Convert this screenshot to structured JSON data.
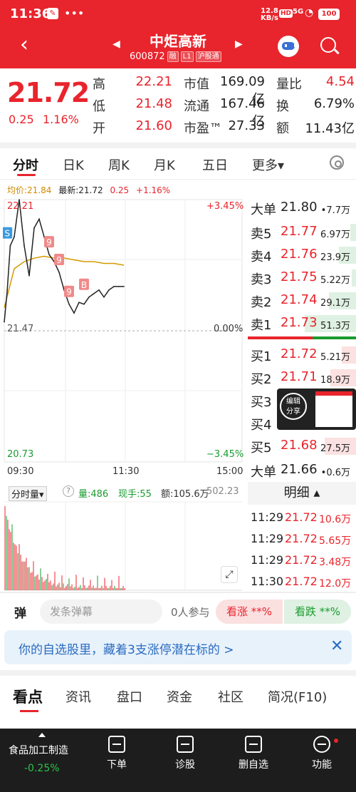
{
  "status_bar": {
    "time": "11:36",
    "net_speed": "12.8",
    "net_unit": "KB/s",
    "hd": "HD",
    "signal": "5G",
    "battery": "100"
  },
  "header": {
    "stock_name": "中炬高新",
    "stock_code": "600872",
    "tags": [
      "融",
      "L1",
      "沪股通"
    ]
  },
  "quote": {
    "price": "21.72",
    "change": "0.25",
    "change_pct": "1.16%",
    "rows": [
      {
        "l1": "高",
        "v1": "22.21",
        "l2": "市值",
        "v2": "169.09亿",
        "l3": "量比",
        "v3": "4.54"
      },
      {
        "l1": "低",
        "v1": "21.48",
        "l2": "流通",
        "v2": "167.46亿",
        "l3": "换",
        "v3": "6.79%"
      },
      {
        "l1": "开",
        "v1": "21.60",
        "l2": "市盈™",
        "v2": "27.33",
        "l3": "额",
        "v3": "11.43亿"
      }
    ]
  },
  "tabs": [
    "分时",
    "日K",
    "周K",
    "月K",
    "五日",
    "更多▾"
  ],
  "info_line": {
    "avg_label": "均价:21.84",
    "latest_label": "最新:21.72",
    "chg": "0.25",
    "chg_pct": "+1.16%"
  },
  "chart_labels": {
    "top_left": "22.21",
    "top_right": "+3.45%",
    "mid_left": "21.47",
    "mid_right": "0.00%",
    "bot_left": "20.73",
    "bot_right": "−3.45%",
    "time_start": "09:30",
    "time_mid": "11:30",
    "time_end": "15:00"
  },
  "volume_bar": {
    "label": "分时量▾",
    "vol": "量:486",
    "now": "现手:55",
    "amount": "额:105.6万",
    "max": "502.23"
  },
  "order_book": {
    "big_sell": {
      "k": "大单",
      "p": "21.80",
      "v": "•7.7万"
    },
    "asks": [
      {
        "k": "卖5",
        "p": "21.77",
        "v": "6.97万"
      },
      {
        "k": "卖4",
        "p": "21.76",
        "v": "23.9万"
      },
      {
        "k": "卖3",
        "p": "21.75",
        "v": "5.22万"
      },
      {
        "k": "卖2",
        "p": "21.74",
        "v": "29.1万"
      },
      {
        "k": "卖1",
        "p": "21.73",
        "v": "51.3万"
      }
    ],
    "bids": [
      {
        "k": "买1",
        "p": "21.72",
        "v": "5.21万"
      },
      {
        "k": "买2",
        "p": "21.71",
        "v": "18.9万"
      },
      {
        "k": "买3",
        "p": "",
        "v": ""
      },
      {
        "k": "买4",
        "p": "",
        "v": ""
      },
      {
        "k": "买5",
        "p": "21.68",
        "v": "27.5万"
      }
    ],
    "big_buy": {
      "k": "大单",
      "p": "21.66",
      "v": "•0.6万"
    }
  },
  "share_widget": {
    "l1": "编辑",
    "l2": "分享"
  },
  "detail": {
    "title": "明细 ▴",
    "rows": [
      {
        "t": "11:29",
        "p": "21.72",
        "v": "10.6万"
      },
      {
        "t": "11:29",
        "p": "21.72",
        "v": "5.65万"
      },
      {
        "t": "11:29",
        "p": "21.72",
        "v": "3.48万"
      },
      {
        "t": "11:30",
        "p": "21.72",
        "v": "12.0万"
      }
    ]
  },
  "barrage": {
    "dan": "弹",
    "placeholder": "发条弹幕",
    "count": "0人参与",
    "up": "看涨 **%",
    "down": "看跌 **%"
  },
  "banner": {
    "text": "你的自选股里，藏着3支涨停潜在标的 >",
    "close": "✕"
  },
  "news_tabs": [
    "看点",
    "资讯",
    "盘口",
    "资金",
    "社区",
    "简况(F10)"
  ],
  "bottom": {
    "sector": "食品加工制造",
    "sector_chg": "-0.25%",
    "items": [
      "下单",
      "诊股",
      "删自选",
      "功能"
    ]
  },
  "chart_data": {
    "type": "line",
    "title": "",
    "x_range": [
      "09:30",
      "15:00"
    ],
    "ylim": [
      20.73,
      22.21
    ],
    "prev_close": 21.47,
    "series": [
      {
        "name": "",
        "x": [
          "09:30",
          "09:33",
          "09:36",
          "09:40",
          "09:45",
          "09:50",
          "09:55",
          "10:00",
          "10:05",
          "10:10",
          "10:15",
          "10:20",
          "10:25",
          "10:30",
          "10:35",
          "10:40",
          "10:45",
          "10:50",
          "10:55",
          "11:00",
          "11:05",
          "11:10",
          "11:15",
          "11:20",
          "11:25",
          "11:30"
        ],
        "values": [
          21.52,
          21.7,
          21.95,
          22.0,
          22.21,
          21.95,
          21.78,
          22.05,
          22.1,
          22.0,
          21.9,
          21.86,
          21.8,
          21.7,
          21.62,
          21.57,
          21.63,
          21.62,
          21.66,
          21.68,
          21.7,
          21.66,
          21.7,
          21.72,
          21.72,
          21.72
        ]
      },
      {
        "name": "",
        "x": [
          "09:30",
          "09:40",
          "09:50",
          "10:00",
          "10:10",
          "10:20",
          "10:30",
          "10:40",
          "10:50",
          "11:00",
          "11:10",
          "11:20",
          "11:30"
        ],
        "values": [
          21.6,
          21.82,
          21.86,
          21.88,
          21.89,
          21.88,
          21.88,
          21.87,
          21.86,
          21.86,
          21.85,
          21.85,
          21.84
        ]
      }
    ]
  }
}
